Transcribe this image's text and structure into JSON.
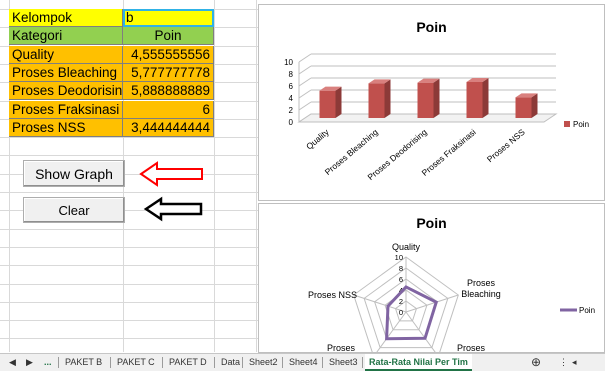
{
  "table": {
    "rows": [
      {
        "label": "Kelompok",
        "value": "b"
      },
      {
        "label": "Kategori",
        "value": "Poin"
      },
      {
        "label": "Quality",
        "value": "4,555555556"
      },
      {
        "label": "Proses Bleaching",
        "value": "5,777777778"
      },
      {
        "label": "Proses Deodorising",
        "value": "5,888888889"
      },
      {
        "label": "Proses Fraksinasi",
        "value": "6"
      },
      {
        "label": "Proses NSS",
        "value": "3,444444444"
      }
    ]
  },
  "buttons": {
    "show_graph": "Show Graph",
    "clear": "Clear"
  },
  "colors": {
    "red_arrow": "#ff0000",
    "black_arrow": "#000000",
    "bar": "#c0504d",
    "radar": "#8064a2"
  },
  "chart_data": [
    {
      "type": "bar",
      "title": "Poin",
      "categories": [
        "Quality",
        "Proses Bleaching",
        "Proses Deodorising",
        "Proses Fraksinasi",
        "Proses NSS"
      ],
      "series": [
        {
          "name": "Poin",
          "values": [
            4.555555556,
            5.777777778,
            5.888888889,
            6,
            3.444444444
          ]
        }
      ],
      "ylim": [
        0,
        10
      ],
      "yticks": [
        "0",
        "2",
        "4",
        "6",
        "8",
        "10"
      ],
      "grid": true,
      "legend": "right"
    },
    {
      "type": "radar",
      "title": "Poin",
      "categories": [
        "Quality",
        "Proses Bleaching",
        "Proses Deodorising",
        "Proses Fraksinasi",
        "Proses NSS"
      ],
      "visible_labels": [
        "Quality",
        "Proses Bleaching",
        "Proses",
        "Proses",
        "Proses NSS"
      ],
      "series": [
        {
          "name": "Poin",
          "values": [
            4.555555556,
            5.777777778,
            5.888888889,
            6,
            3.444444444
          ]
        }
      ],
      "rlim": [
        0,
        10
      ],
      "rticks": [
        "0",
        "2",
        "4",
        "6",
        "8",
        "10"
      ],
      "legend": "right"
    }
  ],
  "tabs": {
    "ellipsis": "...",
    "items": [
      "PAKET B",
      "PAKET C",
      "PAKET D",
      "Data",
      "Sheet2",
      "Sheet4",
      "Sheet3",
      "Rata-Rata Nilai Per Tim"
    ],
    "active": "Rata-Rata Nilai Per Tim"
  }
}
